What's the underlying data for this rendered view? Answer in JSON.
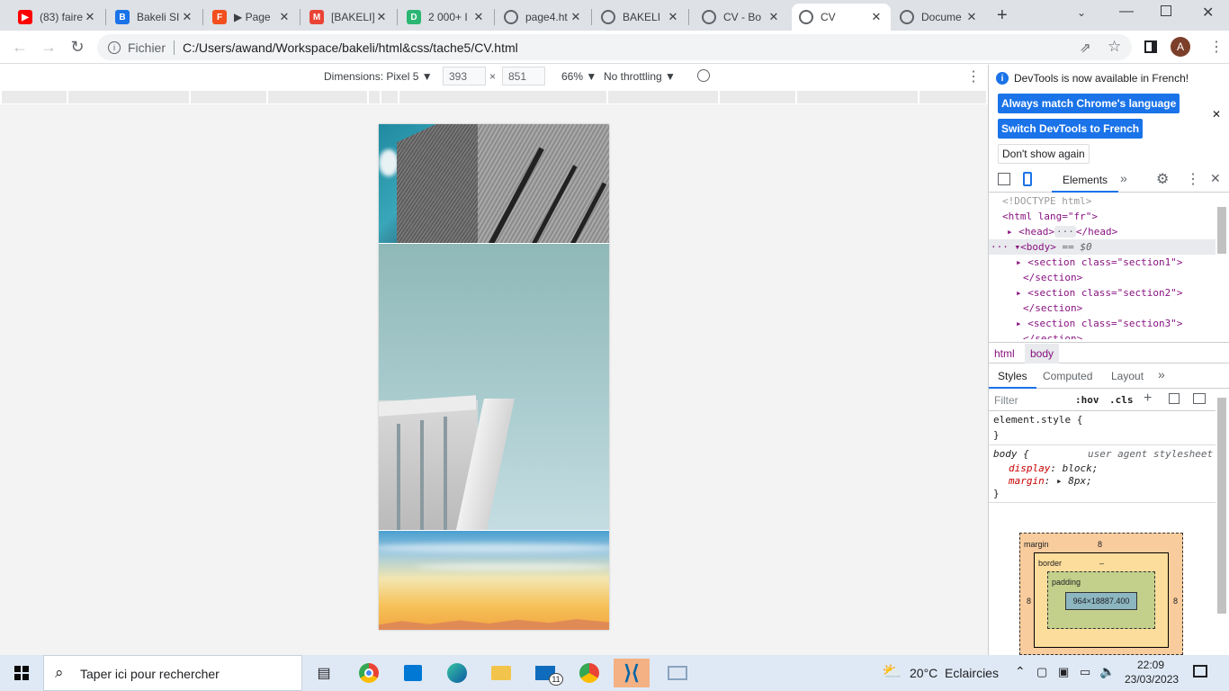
{
  "tabs": [
    {
      "title": "(83) faire",
      "icon": "youtube-icon",
      "color": "#ff0000"
    },
    {
      "title": "Bakeli SI",
      "icon": "bakeli-icon",
      "color": "#1a73e8"
    },
    {
      "title": "▶ Page",
      "icon": "figma-icon",
      "color": "#f24e1e"
    },
    {
      "title": "[BAKELI]",
      "icon": "gmail-icon",
      "color": "#ea4335"
    },
    {
      "title": "2 000+ I",
      "icon": "d-icon",
      "color": "#2bb673"
    },
    {
      "title": "page4.ht",
      "icon": "globe-icon",
      "color": "#5f6368"
    },
    {
      "title": "BAKELI",
      "icon": "globe-icon",
      "color": "#5f6368"
    },
    {
      "title": "CV - Bo",
      "icon": "globe-icon",
      "color": "#5f6368"
    },
    {
      "title": "CV",
      "icon": "globe-icon",
      "color": "#5f6368"
    },
    {
      "title": "Docume",
      "icon": "globe-icon",
      "color": "#5f6368"
    }
  ],
  "address": {
    "scheme_label": "Fichier",
    "path": "C:/Users/awand/Workspace/bakeli/html&css/tache5/CV.html",
    "profile_initial": "A"
  },
  "device_toolbar": {
    "dimensions": "Dimensions: Pixel 5 ▼",
    "width": "393",
    "times": "×",
    "height": "851",
    "zoom": "66% ▼",
    "throttling": "No throttling ▼"
  },
  "devtools": {
    "notice": "DevTools is now available in French!",
    "btn_match": "Always match Chrome's language",
    "btn_switch": "Switch DevTools to French",
    "btn_dontshow": "Don't show again",
    "tab_elements": "Elements",
    "dom": {
      "doctype": "<!DOCTYPE html>",
      "html_open": "<html lang=\"fr\">",
      "head": "<head>",
      "head_close": "</head>",
      "body": "<body>",
      "body_eq": "== $0",
      "sec1": "<section class=\"section1\">",
      "sec2": "<section class=\"section2\">",
      "sec3": "<section class=\"section3\">",
      "sec_close": "</section>"
    },
    "breadcrumb": [
      "html",
      "body"
    ],
    "styles_tabs": [
      "Styles",
      "Computed",
      "Layout"
    ],
    "filter_placeholder": "Filter",
    "hov": ":hov",
    "cls": ".cls",
    "element_style": "element.style {",
    "close_brace": "}",
    "body_rule": "body {",
    "ua_label": "user agent stylesheet",
    "prop_display": "display",
    "val_display": "block;",
    "prop_margin": "margin",
    "val_margin": "8px;",
    "box": {
      "margin_label": "margin",
      "margin": "8",
      "border_label": "border",
      "padding_label": "padding",
      "dash": "–",
      "content": "964×18887.400",
      "side": "8"
    }
  },
  "taskbar": {
    "search_placeholder": "Taper ici pour rechercher",
    "weather": "20°C  Eclaircies",
    "time": "22:09",
    "date": "23/03/2023",
    "mail_badge": "11"
  }
}
